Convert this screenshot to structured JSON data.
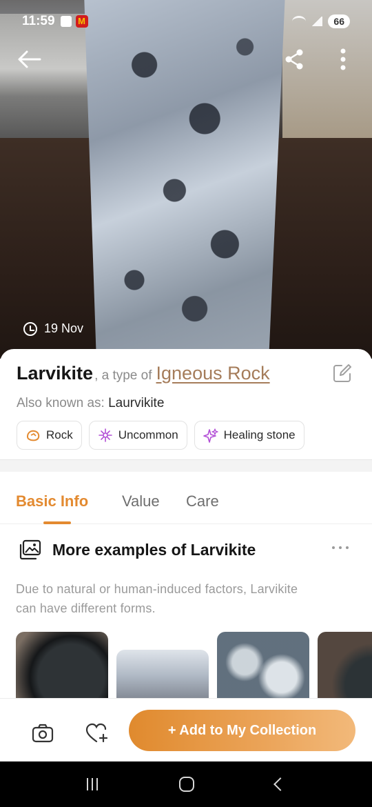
{
  "status_bar": {
    "time": "11:59",
    "battery": "66",
    "icons": [
      "notification-icon",
      "mcdonalds-icon",
      "wifi-icon",
      "signal-icon",
      "battery-icon"
    ]
  },
  "header": {
    "back_icon": "arrow-left-icon",
    "share_icon": "share-icon",
    "more_icon": "more-vertical-icon"
  },
  "photo": {
    "date": "19 Nov",
    "date_icon": "clock-icon"
  },
  "identification": {
    "name": "Larvikite",
    "type_prefix": ", a type of",
    "type_link": "Igneous Rock",
    "edit_icon": "edit-icon",
    "aka_label": "Also known as:",
    "aka_value": "Laurvikite",
    "chips": [
      {
        "label": "Rock",
        "icon": "rock-icon",
        "color": "#e38a30"
      },
      {
        "label": "Uncommon",
        "icon": "sparkle-icon",
        "color": "#b24fd6"
      },
      {
        "label": "Healing stone",
        "icon": "healing-sparkle-icon",
        "color": "#b24fd6"
      }
    ]
  },
  "tabs": [
    {
      "label": "Basic Info",
      "active": true
    },
    {
      "label": "Value",
      "active": false
    },
    {
      "label": "Care",
      "active": false
    }
  ],
  "examples_section": {
    "icon": "image-gallery-icon",
    "title": "More examples of Larvikite",
    "more_icon": "more-horizontal-icon",
    "description": "Due to natural or human-induced factors, Larvikite can have different forms."
  },
  "bottom_bar": {
    "camera_icon": "camera-icon",
    "favorite_icon": "heart-plus-icon",
    "add_button_label": "+ Add to My Collection",
    "accent_color": "#e38a30"
  },
  "nav_bar": {
    "recent_icon": "recent-apps-icon",
    "home_icon": "home-icon",
    "back_icon": "nav-back-icon"
  }
}
